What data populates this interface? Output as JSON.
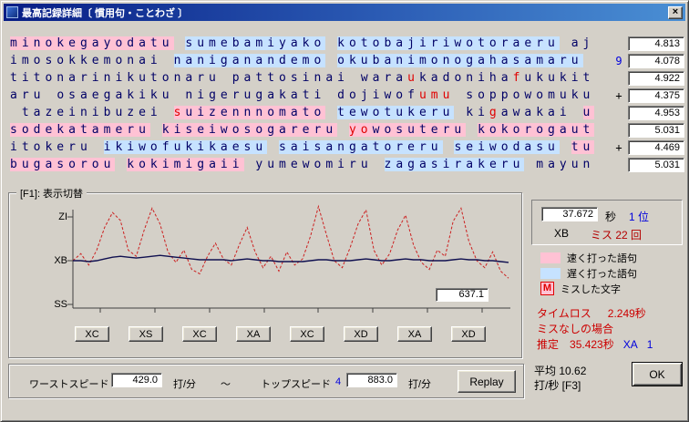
{
  "window": {
    "title": "最高記録詳細〔 慣用句・ことわざ 〕",
    "close_label": "×"
  },
  "rows": [
    {
      "segments": [
        {
          "t": "minokegayodatu",
          "bg": "p"
        },
        {
          "t": " "
        },
        {
          "t": "sumebamiyako",
          "bg": "b"
        },
        {
          "t": " "
        },
        {
          "t": "kotobajiriwotoraeru",
          "bg": "b"
        },
        {
          "t": " "
        },
        {
          "t": "aj"
        }
      ],
      "prefix": "",
      "time": "4.813"
    },
    {
      "segments": [
        {
          "t": "imosokkemonai"
        },
        {
          "t": " "
        },
        {
          "t": "naniganandemo",
          "bg": "b"
        },
        {
          "t": " "
        },
        {
          "t": "okubanimonogahasamaru",
          "bg": "b"
        }
      ],
      "prefix": "9",
      "prefix_color": "blue",
      "time": "4.078"
    },
    {
      "segments": [
        {
          "t": "titonarinikutonaru"
        },
        {
          "t": " "
        },
        {
          "t": "pattosinai"
        },
        {
          "t": " "
        },
        {
          "t": "wara"
        },
        {
          "t": "u",
          "miss": true
        },
        {
          "t": "kadoniha"
        },
        {
          "t": "f",
          "miss": true
        },
        {
          "t": "ukukit"
        }
      ],
      "prefix": "",
      "time": "4.922"
    },
    {
      "segments": [
        {
          "t": "aru"
        },
        {
          "t": " "
        },
        {
          "t": "osaegakiku"
        },
        {
          "t": " "
        },
        {
          "t": "nigerugakati"
        },
        {
          "t": " "
        },
        {
          "t": "dojiwof"
        },
        {
          "t": "umu",
          "miss": true
        },
        {
          "t": " "
        },
        {
          "t": "soppowomuku"
        }
      ],
      "prefix": "+",
      "time": "4.375"
    },
    {
      "segments": [
        {
          "t": " "
        },
        {
          "t": "tazeinibuzei"
        },
        {
          "t": " "
        },
        {
          "t": "s",
          "bg": "p",
          "miss": true
        },
        {
          "t": "uizennnomato",
          "bg": "p"
        },
        {
          "t": " "
        },
        {
          "t": "tewotukeru",
          "bg": "b"
        },
        {
          "t": " "
        },
        {
          "t": "ki"
        },
        {
          "t": "g",
          "miss": true
        },
        {
          "t": "awakai"
        },
        {
          "t": " "
        },
        {
          "t": "u",
          "bg": "p"
        }
      ],
      "prefix": "",
      "time": "4.953"
    },
    {
      "segments": [
        {
          "t": "sodekatameru",
          "bg": "p"
        },
        {
          "t": " "
        },
        {
          "t": "kiseiwosogareru",
          "bg": "p"
        },
        {
          "t": " "
        },
        {
          "t": "yo",
          "bg": "p",
          "miss": true
        },
        {
          "t": "wosuteru",
          "bg": "p"
        },
        {
          "t": " "
        },
        {
          "t": "kokorogaut",
          "bg": "p"
        }
      ],
      "prefix": "",
      "time": "5.031"
    },
    {
      "segments": [
        {
          "t": "itokeru"
        },
        {
          "t": " "
        },
        {
          "t": "ikiwofukikaesu",
          "bg": "b"
        },
        {
          "t": " "
        },
        {
          "t": "saisangatoreru",
          "bg": "b"
        },
        {
          "t": " "
        },
        {
          "t": "seiwodasu",
          "bg": "b"
        },
        {
          "t": " "
        },
        {
          "t": "tu",
          "bg": "p"
        }
      ],
      "prefix": "+",
      "time": "4.469"
    },
    {
      "segments": [
        {
          "t": "bugasorou",
          "bg": "p"
        },
        {
          "t": " "
        },
        {
          "t": "kokimigaii",
          "bg": "p"
        },
        {
          "t": " "
        },
        {
          "t": "yumewomiru"
        },
        {
          "t": " "
        },
        {
          "t": "zagasirakeru",
          "bg": "b"
        },
        {
          "t": " "
        },
        {
          "t": "mayun"
        }
      ],
      "prefix": "",
      "time": "5.031"
    }
  ],
  "graph": {
    "group_label": "[F1]: 表示切替",
    "y_labels": [
      "ZI",
      "XB",
      "SS"
    ],
    "value_box": "637.1",
    "lap_buttons": [
      "XC",
      "XS",
      "XC",
      "XA",
      "XC",
      "XD",
      "XA",
      "XD"
    ],
    "colors": {
      "instant": "#cc2020",
      "average": "#101050"
    },
    "series": {
      "instant": [
        0.5,
        0.58,
        0.45,
        0.62,
        0.88,
        1.05,
        0.96,
        0.62,
        0.55,
        0.85,
        1.1,
        0.92,
        0.6,
        0.48,
        0.62,
        0.4,
        0.35,
        0.55,
        0.7,
        0.52,
        0.45,
        0.68,
        0.88,
        0.6,
        0.42,
        0.55,
        0.38,
        0.6,
        0.45,
        0.52,
        0.78,
        1.12,
        0.8,
        0.5,
        0.42,
        0.65,
        0.92,
        1.08,
        0.62,
        0.45,
        0.58,
        0.85,
        1.02,
        0.68,
        0.48,
        0.4,
        0.62,
        0.55,
        0.95,
        1.1,
        0.72,
        0.5,
        0.42,
        0.6,
        0.38,
        0.3
      ],
      "average": [
        0.5,
        0.5,
        0.49,
        0.5,
        0.52,
        0.54,
        0.55,
        0.54,
        0.53,
        0.54,
        0.55,
        0.56,
        0.55,
        0.54,
        0.53,
        0.52,
        0.51,
        0.51,
        0.51,
        0.51,
        0.5,
        0.51,
        0.52,
        0.51,
        0.5,
        0.5,
        0.49,
        0.49,
        0.49,
        0.49,
        0.5,
        0.51,
        0.51,
        0.5,
        0.5,
        0.5,
        0.51,
        0.52,
        0.51,
        0.5,
        0.5,
        0.51,
        0.52,
        0.51,
        0.51,
        0.5,
        0.5,
        0.5,
        0.51,
        0.52,
        0.51,
        0.51,
        0.5,
        0.5,
        0.49,
        0.48
      ]
    }
  },
  "stats": {
    "time": "37.672",
    "unit": "秒",
    "place": "1 位",
    "rank": "XB",
    "miss": "ミス 22 回"
  },
  "legend": [
    {
      "color": "#ffc2d4",
      "label": "速く打った語句"
    },
    {
      "color": "#c6e2ff",
      "label": "遅く打った語句"
    },
    {
      "mark": "M",
      "label": "ミスした文字"
    }
  ],
  "analysis": {
    "timeloss_label": "タイムロス",
    "timeloss_value": "2.249秒",
    "nomiss_label": "ミスなしの場合",
    "estimate_label": "推定",
    "estimate_value": "35.423秒",
    "estimate_rank": "XA",
    "estimate_place": "1"
  },
  "speed": {
    "worst_label": "ワーストスピード",
    "worst_value": "429.0",
    "unit1": "打/分",
    "tilde": "～",
    "top_label": "トップスピード",
    "top_count": "4",
    "top_value": "883.0",
    "unit2": "打/分",
    "replay_label": "Replay"
  },
  "footer": {
    "average": "平均 10.62",
    "rate": "打/秒 [F3]",
    "ok_label": "OK"
  }
}
